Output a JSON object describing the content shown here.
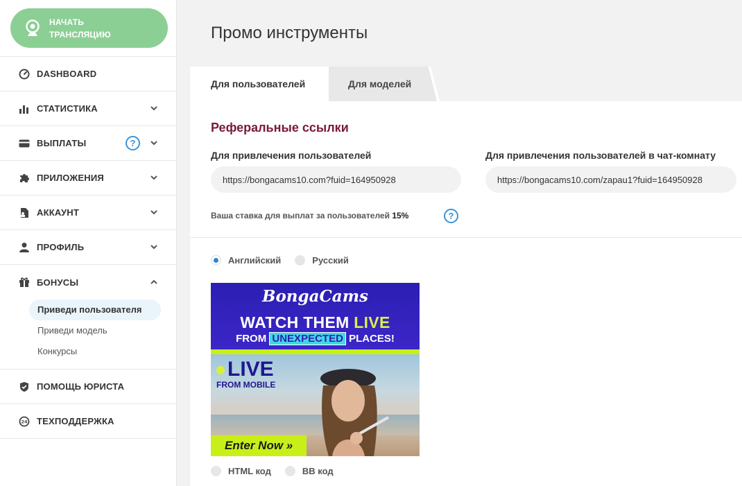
{
  "sidebar": {
    "stream_button": "НАЧАТЬ ТРАНСЛЯЦИЮ",
    "items": [
      {
        "label": "DASHBOARD",
        "icon": "dashboard-gauge-icon"
      },
      {
        "label": "СТАТИСТИКА",
        "icon": "bar-chart-icon"
      },
      {
        "label": "ВЫПЛАТЫ",
        "icon": "credit-card-icon"
      },
      {
        "label": "ПРИЛОЖЕНИЯ",
        "icon": "puzzle-icon"
      },
      {
        "label": "АККАУНТ",
        "icon": "account-icon"
      },
      {
        "label": "ПРОФИЛЬ",
        "icon": "user-icon"
      },
      {
        "label": "БОНУСЫ",
        "icon": "gift-icon"
      },
      {
        "label": "ПОМОЩЬ ЮРИСТА",
        "icon": "shield-icon"
      },
      {
        "label": "ТЕХПОДДЕРЖКА",
        "icon": "support-24-icon"
      }
    ],
    "help_mark": "?",
    "bonus_subitems": [
      "Приведи пользователя",
      "Приведи модель",
      "Конкурсы"
    ]
  },
  "main": {
    "title": "Промо инструменты",
    "tabs": [
      {
        "label": "Для пользователей",
        "active": true
      },
      {
        "label": "Для моделей",
        "active": false
      }
    ],
    "section_title": "Реферальные ссылки",
    "link1_label": "Для привлечения пользователей",
    "link1_value": "https://bongacams10.com?fuid=164950928",
    "link2_label": "Для привлечения пользователей в чат-комнату",
    "link2_value": "https://bongacams10.com/zapau1?fuid=164950928",
    "rate_text": "Ваша ставка для выплат за пользователей",
    "rate_value": "15%",
    "rate_help": "?",
    "languages": [
      {
        "label": "Английский",
        "selected": true
      },
      {
        "label": "Русский",
        "selected": false
      }
    ],
    "banner": {
      "logo": "BongaCams",
      "line1_a": "WATCH THEM ",
      "line1_b": "LIVE",
      "line2_a": "FROM ",
      "line2_b": "UNEXPECTED",
      "line2_c": " PLACES!",
      "live": "LIVE",
      "from_mobile": "FROM MOBILE",
      "enter": "Enter Now »"
    },
    "code_types": [
      {
        "label": "HTML код",
        "selected": false
      },
      {
        "label": "BB код",
        "selected": false
      }
    ]
  },
  "colors": {
    "accent_green": "#8ccf94",
    "section_title": "#7a1a3a",
    "help_blue": "#3a93d8",
    "radio_blue": "#2f86d0"
  }
}
